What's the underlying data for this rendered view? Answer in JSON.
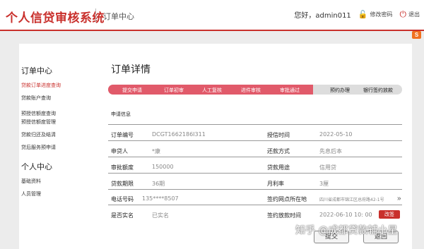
{
  "header": {
    "logo": "个人信贷审核系统",
    "crumb": "订单中心",
    "greeting": "您好，admin011",
    "change_password": "修改密码",
    "logout": "退出",
    "badge": "S"
  },
  "sidebar": {
    "section1": "订单中心",
    "items1": [
      "贷款订单进度查询",
      "贷款账户查询",
      "预授信额度查询",
      "预授信额度管理",
      "贷款归还及结清",
      "贷后服务预申请"
    ],
    "section2": "个人中心",
    "items2": [
      "基础资料",
      "人员管理"
    ]
  },
  "main": {
    "title": "订单详情",
    "steps": [
      "提交申请",
      "订单初审",
      "人工复核",
      "进件审核",
      "审批通过",
      "预约办理",
      "银行签约放款"
    ],
    "completed_steps": 5,
    "info_title": "申请信息"
  },
  "details": {
    "rows": [
      {
        "l1": "订单编号",
        "v1": "DCGT1662186I311",
        "l2": "授信时间",
        "v2": "2022-05-10"
      },
      {
        "l1": "申贷人",
        "v1": "*康",
        "l2": "还款方式",
        "v2": "先息后本"
      },
      {
        "l1": "审批额度",
        "v1": "150000",
        "l2": "贷款用途",
        "v2": "信用贷"
      },
      {
        "l1": "贷款期限",
        "v1": "36期",
        "l2": "月利率",
        "v2": "3厘"
      },
      {
        "l1": "电话号码",
        "v1": "135****8507",
        "l2": "签约网点所在地",
        "v2": "四川省成都市锦江区总府路42-1号"
      },
      {
        "l1": "是否实名",
        "v1": "已实名",
        "l2": "签约放款时间",
        "v2": "2022-06-10 10: 00"
      }
    ],
    "change_label": "改签"
  },
  "buttons": {
    "submit": "提交",
    "back": "返回"
  },
  "watermark": "知乎 @成都贷款辅小星",
  "colors": {
    "brand_red": "#c9302c",
    "step_done": "#e15a6a",
    "step_todo": "#dddddd"
  }
}
